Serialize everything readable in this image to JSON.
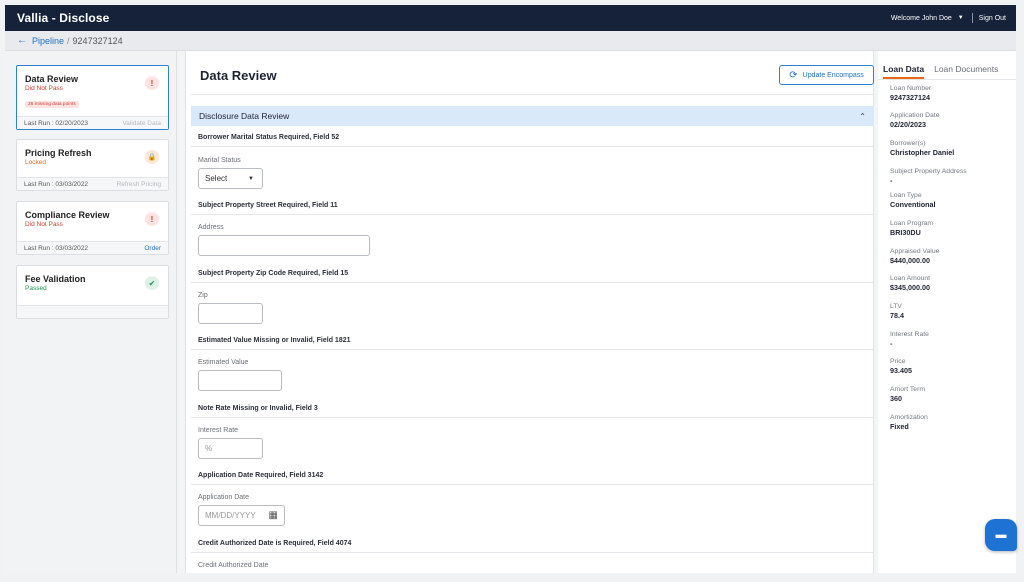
{
  "app": {
    "title": "Vallia - Disclose",
    "welcome": "Welcome John Doe",
    "sign_out": "Sign Out"
  },
  "breadcrumb": {
    "link": "Pipeline",
    "separator": "/",
    "current": "9247327124"
  },
  "sidebar": {
    "cards": [
      {
        "title": "Data Review",
        "status": "Did Not Pass",
        "badge": "26 missing data points",
        "last_run": "Last Run : 02/20/2023",
        "action": "Validate Data",
        "icon": "exclamation-icon"
      },
      {
        "title": "Pricing Refresh",
        "status": "Locked",
        "last_run": "Last Run : 03/03/2022",
        "action": "Refresh Pricing",
        "icon": "lock-icon"
      },
      {
        "title": "Compliance Review",
        "status": "Did Not Pass",
        "last_run": "Last Run : 03/03/2022",
        "action": "Order",
        "icon": "exclamation-icon"
      },
      {
        "title": "Fee Validation",
        "status": "Passed",
        "icon": "check-icon"
      }
    ]
  },
  "main": {
    "title": "Data Review",
    "update_button": "Update Encompass",
    "section_title": "Disclosure Data Review",
    "fields": [
      {
        "heading": "Borrower Marital Status Required, Field 52",
        "label": "Marital Status",
        "value": "Select"
      },
      {
        "heading": "Subject Property Street Required, Field 11",
        "label": "Address"
      },
      {
        "heading": "Subject Property Zip Code Required, Field 15",
        "label": "Zip"
      },
      {
        "heading": "Estimated Value Missing or Invalid, Field 1821",
        "label": "Estimated Value"
      },
      {
        "heading": "Note Rate Missing or Invalid, Field 3",
        "label": "Interest Rate",
        "placeholder": "%"
      },
      {
        "heading": "Application Date Required, Field 3142",
        "label": "Application Date",
        "placeholder": "MM/DD/YYYY"
      },
      {
        "heading": "Credit Authorized Date is Required, Field 4074",
        "label": "Credit Authorized Date"
      }
    ]
  },
  "loan_panel": {
    "tabs": [
      "Loan Data",
      "Loan Documents"
    ],
    "items": [
      {
        "label": "Loan Number",
        "value": "9247327124"
      },
      {
        "label": "Application Date",
        "value": "02/20/2023"
      },
      {
        "label": "Borrower(s)",
        "value": "Christopher Daniel"
      },
      {
        "label": "Subject Property Address",
        "value": "-"
      },
      {
        "label": "Loan Type",
        "value": "Conventional"
      },
      {
        "label": "Loan Program",
        "value": "BRI30DU"
      },
      {
        "label": "Appraised Value",
        "value": "$440,000.00"
      },
      {
        "label": "Loan Amount",
        "value": "$345,000.00"
      },
      {
        "label": "LTV",
        "value": "78.4"
      },
      {
        "label": "Interest Rate",
        "value": "-"
      },
      {
        "label": "Price",
        "value": "93.405"
      },
      {
        "label": "Amort Term",
        "value": "360"
      },
      {
        "label": "Amortization",
        "value": "Fixed"
      }
    ]
  },
  "colors": {
    "topbar": "#16213a",
    "accent": "#1d6fc7",
    "fail": "#d63a2d",
    "locked": "#e86b15",
    "pass": "#22955a"
  }
}
